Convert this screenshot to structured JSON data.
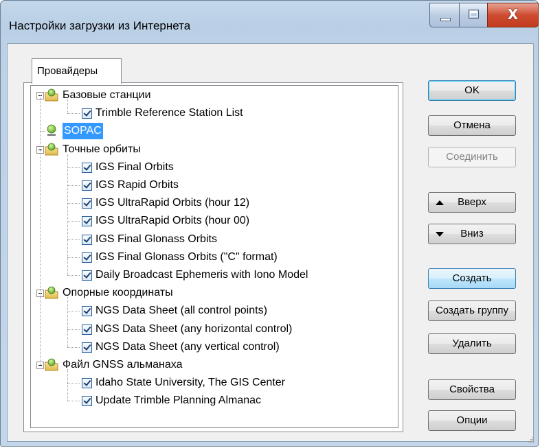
{
  "window": {
    "title": "Настройки загрузки из Интернета",
    "close_glyph": "X"
  },
  "tabs": [
    {
      "label": "Провайдеры",
      "active": true
    }
  ],
  "tree": {
    "groups": [
      {
        "label": "Базовые станции",
        "icon": "folder-globe-icon",
        "expanded": true,
        "items": [
          {
            "label": "Trimble Reference Station List",
            "checked": true
          }
        ]
      },
      {
        "label": "SOPAC",
        "icon": "globe-icon",
        "selected": true,
        "items": []
      },
      {
        "label": "Точные орбиты",
        "icon": "folder-globe-icon",
        "expanded": true,
        "items": [
          {
            "label": "IGS Final Orbits",
            "checked": true
          },
          {
            "label": "IGS Rapid Orbits",
            "checked": true
          },
          {
            "label": "IGS UltraRapid Orbits (hour 12)",
            "checked": true
          },
          {
            "label": "IGS UltraRapid Orbits (hour 00)",
            "checked": true
          },
          {
            "label": "IGS Final Glonass Orbits",
            "checked": true
          },
          {
            "label": "IGS Final Glonass Orbits (\"C\" format)",
            "checked": true
          },
          {
            "label": "Daily Broadcast Ephemeris with Iono Model",
            "checked": true
          }
        ]
      },
      {
        "label": "Опорные координаты",
        "icon": "folder-globe-icon",
        "expanded": true,
        "items": [
          {
            "label": "NGS Data Sheet (all control points)",
            "checked": true
          },
          {
            "label": "NGS Data Sheet (any horizontal control)",
            "checked": true
          },
          {
            "label": "NGS Data Sheet (any vertical control)",
            "checked": true
          }
        ]
      },
      {
        "label": "Файл GNSS альманаха",
        "icon": "folder-globe-icon",
        "expanded": true,
        "items": [
          {
            "label": "Idaho State University, The GIS Center",
            "checked": true
          },
          {
            "label": "Update Trimble Planning Almanac",
            "checked": true
          }
        ]
      }
    ]
  },
  "buttons": {
    "ok": "OK",
    "cancel": "Отмена",
    "connect": "Соединить",
    "up": "Вверх",
    "down": "Вниз",
    "create": "Создать",
    "create_group": "Создать группу",
    "delete": "Удалить",
    "properties": "Свойства",
    "options": "Опции"
  },
  "colors": {
    "selection": "#3399ff",
    "title_bar": "#bfd3e8",
    "close_button": "#c9452a"
  }
}
